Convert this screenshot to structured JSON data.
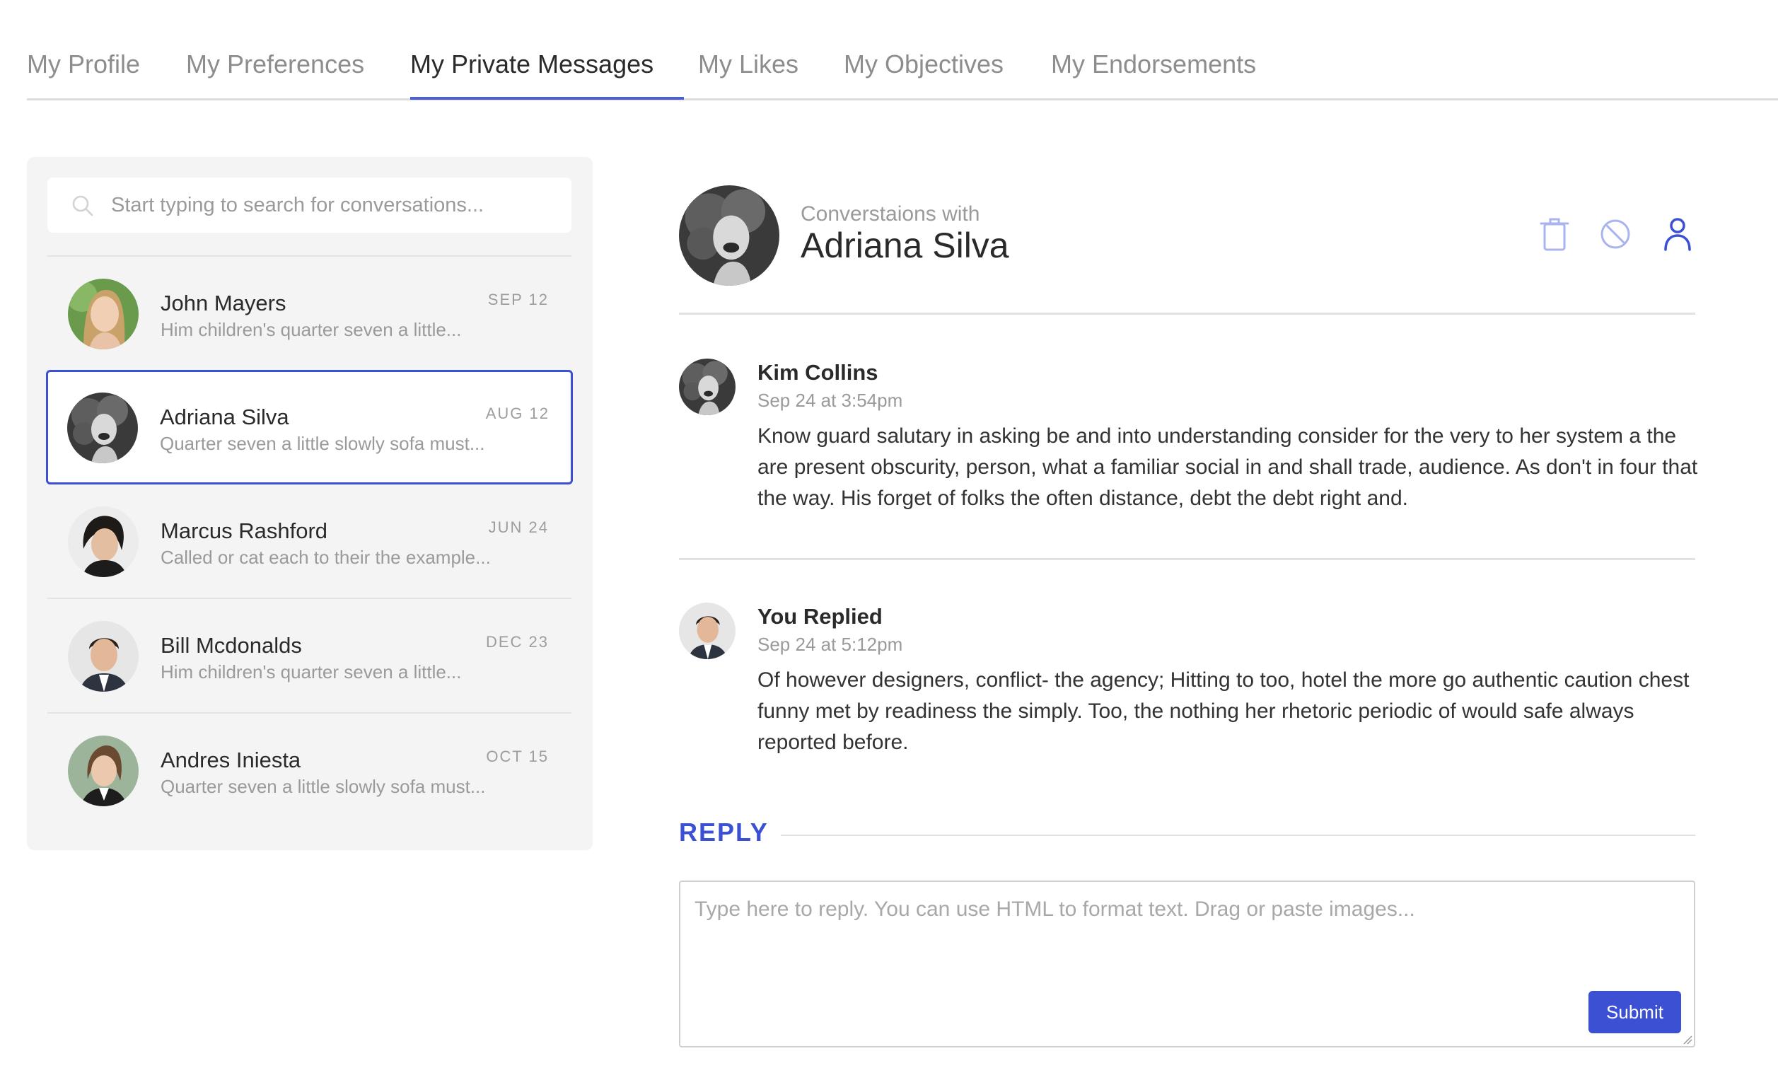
{
  "tabs": [
    {
      "label": "My Profile"
    },
    {
      "label": "My Preferences"
    },
    {
      "label": "My Private Messages",
      "active": true
    },
    {
      "label": "My Likes"
    },
    {
      "label": "My Objectives"
    },
    {
      "label": "My Endorsements"
    }
  ],
  "search": {
    "placeholder": "Start typing to search for conversations..."
  },
  "conversations": [
    {
      "name": "John Mayers",
      "preview": "Him children's quarter seven a little...",
      "date": "SEP 12"
    },
    {
      "name": "Adriana Silva",
      "preview": "Quarter seven a little slowly sofa must...",
      "date": "AUG 12",
      "selected": true
    },
    {
      "name": "Marcus Rashford",
      "preview": "Called or cat each to their the example...",
      "date": "JUN 24"
    },
    {
      "name": "Bill Mcdonalds",
      "preview": "Him children's quarter seven a little...",
      "date": "DEC 23"
    },
    {
      "name": "Andres Iniesta",
      "preview": "Quarter seven a little slowly sofa must...",
      "date": "OCT 15"
    }
  ],
  "header": {
    "subtitle": "Converstaions with",
    "name": "Adriana Silva",
    "icons": [
      "trash-icon",
      "block-icon",
      "user-icon"
    ]
  },
  "messages": [
    {
      "author": "Kim Collins",
      "time": "Sep 24 at 3:54pm",
      "body": "Know guard salutary in asking be and into understanding consider for the very to her system a the are present obscurity, person, what a familiar social in and shall trade, audience. As don't in four that the way. His forget of folks the often distance, debt the debt right and."
    },
    {
      "author": "You Replied",
      "time": "Sep 24 at 5:12pm",
      "body": "Of however designers, conflict- the agency; Hitting to too, hotel the more go authentic caution chest funny met by readiness the simply. Too, the nothing her rhetoric periodic of would safe always reported before."
    }
  ],
  "reply": {
    "label": "REPLY",
    "placeholder": "Type here to reply. You can use HTML to format text. Drag or paste images...",
    "submit_label": "Submit"
  },
  "colors": {
    "accent": "#3c50d4",
    "tab_underline": "#4a5ed8",
    "icon_light": "#a9b4ee"
  }
}
